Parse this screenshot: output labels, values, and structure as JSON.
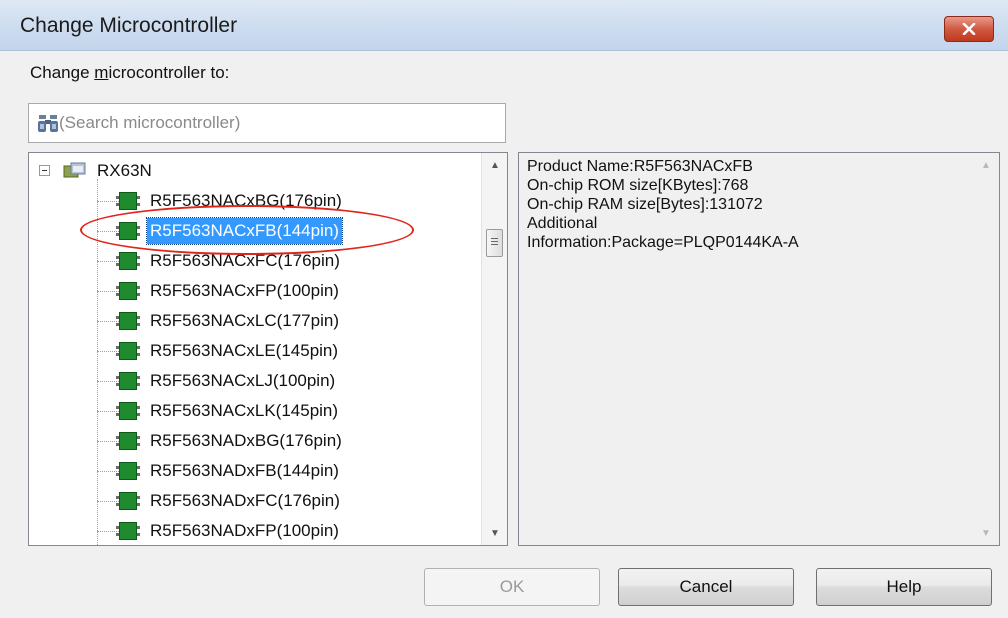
{
  "window": {
    "title": "Change Microcontroller",
    "close_icon": "close-icon"
  },
  "change_label": {
    "prefix": "Change ",
    "access_key": "m",
    "suffix": "icrocontroller to:"
  },
  "search": {
    "placeholder": "(Search microcontroller)",
    "value": "",
    "icon": "binoculars-icon"
  },
  "tree": {
    "root": {
      "label": "RX63N",
      "expanded": true,
      "icon": "folder-icon"
    },
    "items": [
      {
        "label": "R5F563NACxBG(176pin)",
        "selected": false
      },
      {
        "label": "R5F563NACxFB(144pin)",
        "selected": true
      },
      {
        "label": "R5F563NACxFC(176pin)",
        "selected": false
      },
      {
        "label": "R5F563NACxFP(100pin)",
        "selected": false
      },
      {
        "label": "R5F563NACxLC(177pin)",
        "selected": false
      },
      {
        "label": "R5F563NACxLE(145pin)",
        "selected": false
      },
      {
        "label": "R5F563NACxLJ(100pin)",
        "selected": false
      },
      {
        "label": "R5F563NACxLK(145pin)",
        "selected": false
      },
      {
        "label": "R5F563NADxBG(176pin)",
        "selected": false
      },
      {
        "label": "R5F563NADxFB(144pin)",
        "selected": false
      },
      {
        "label": "R5F563NADxFC(176pin)",
        "selected": false
      },
      {
        "label": "R5F563NADxFP(100pin)",
        "selected": false
      }
    ],
    "item_icon": "chip-icon"
  },
  "info": {
    "lines": [
      "Product Name:R5F563NACxFB",
      "On-chip ROM size[KBytes]:768",
      "On-chip RAM size[Bytes]:131072",
      "Additional",
      "Information:Package=PLQP0144KA-A"
    ]
  },
  "buttons": {
    "ok": "OK",
    "ok_enabled": false,
    "cancel": "Cancel",
    "help": "Help"
  },
  "colors": {
    "selection": "#3399ff",
    "highlight_annotation": "#e0261a",
    "titlebar": "#cddcef",
    "close_button": "#d05a42"
  }
}
